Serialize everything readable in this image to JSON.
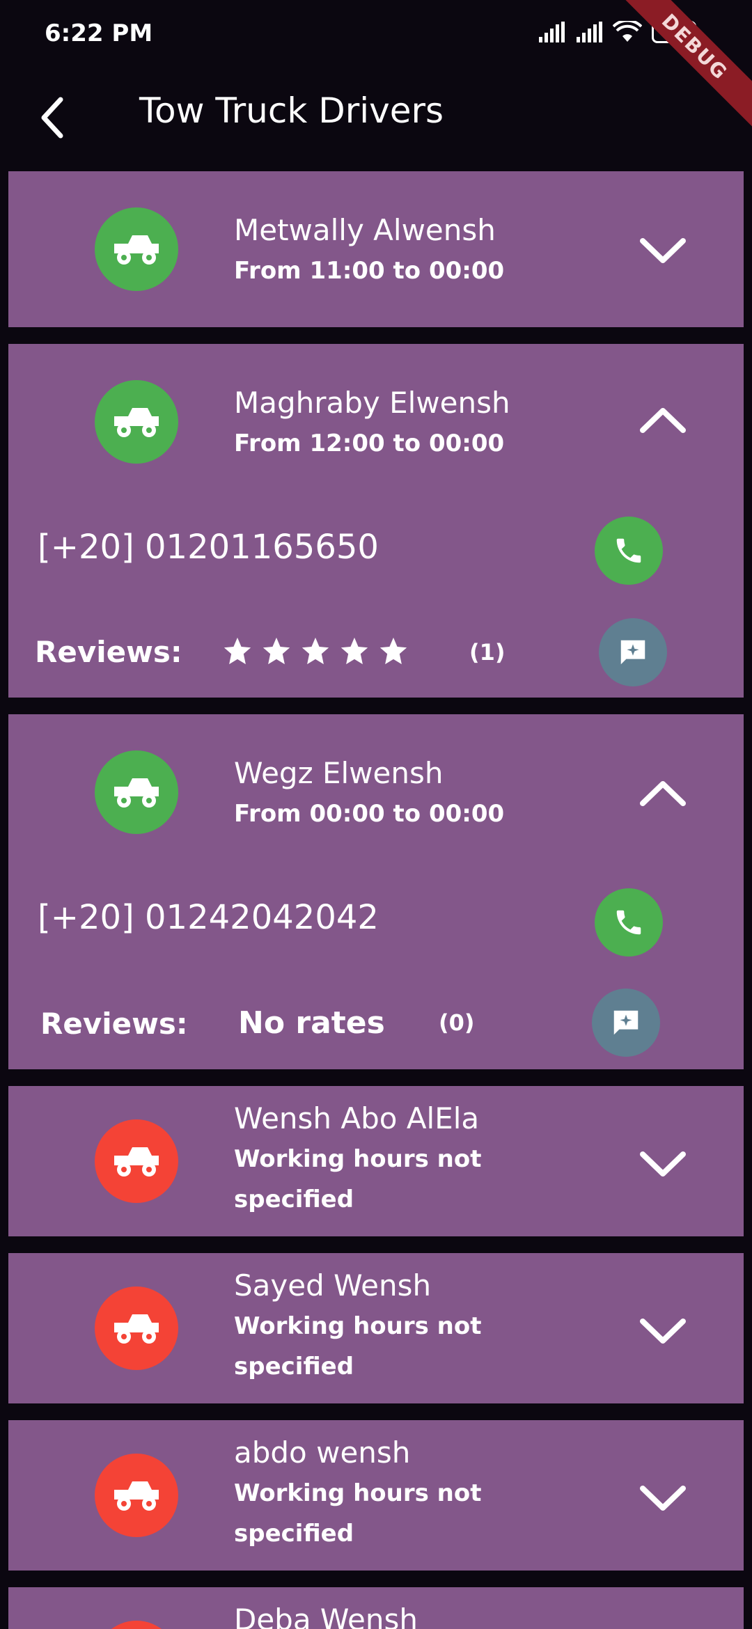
{
  "status": {
    "time": "6:22 PM",
    "battery": "46",
    "debug_label": "DEBUG"
  },
  "appbar": {
    "title": "Tow Truck Drivers"
  },
  "drivers": [
    {
      "name": "Metwally Alwensh",
      "hours": "From 11:00 to 00:00",
      "status_color": "#4caf50",
      "expanded": false
    },
    {
      "name": "Maghraby Elwensh",
      "hours": "From 12:00 to 00:00",
      "status_color": "#4caf50",
      "expanded": true,
      "phone": "[+20] 01201165650",
      "reviews_label": "Reviews:",
      "rating": 5,
      "reviews_count": "(1)"
    },
    {
      "name": "Wegz Elwensh",
      "hours": "From 00:00 to 00:00",
      "status_color": "#4caf50",
      "expanded": true,
      "phone": "[+20] 01242042042",
      "reviews_label": "Reviews:",
      "rating_text": "No rates",
      "reviews_count": "(0)"
    },
    {
      "name": "Wensh Abo AlEla",
      "hours": "Working hours not specified",
      "status_color": "#f44336",
      "expanded": false
    },
    {
      "name": "Sayed Wensh",
      "hours": "Working hours not specified",
      "status_color": "#f44336",
      "expanded": false
    },
    {
      "name": "abdo wensh",
      "hours": "Working hours not specified",
      "status_color": "#f44336",
      "expanded": false
    },
    {
      "name": "Deba Wensh",
      "status_color": "#f44336",
      "expanded": false
    }
  ],
  "icons": {
    "avatar": "tow-truck-icon",
    "expand": "chevron-down-icon",
    "collapse": "chevron-up-icon",
    "call": "phone-icon",
    "review": "add-review-icon",
    "star": "star-icon"
  },
  "colors": {
    "card": "#83578a",
    "available": "#4caf50",
    "unavailable": "#f44336",
    "review_button": "#5f7f91",
    "background": "#0b0710"
  }
}
